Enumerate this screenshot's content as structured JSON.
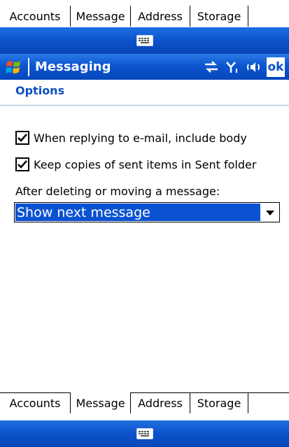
{
  "tabs_top": [
    "Accounts",
    "Message",
    "Address",
    "Storage"
  ],
  "tabs_bottom": [
    "Accounts",
    "Message",
    "Address",
    "Storage"
  ],
  "selected_tab_bottom": "Message",
  "titlebar": {
    "title": "Messaging",
    "ok_label": "ok",
    "icons": [
      "windows-start-icon",
      "connectivity-icon",
      "signal-icon",
      "speaker-icon"
    ]
  },
  "options": {
    "header": "Options",
    "include_body_label": "When replying to e-mail, include body",
    "include_body_checked": true,
    "keep_copies_label": "Keep copies of sent items in Sent folder",
    "keep_copies_checked": true,
    "after_delete_label": "After deleting or moving a message:",
    "after_delete_value": "Show next message"
  },
  "colors": {
    "titlebar_blue": "#0c55cf",
    "selection_blue": "#0a52d2",
    "header_blue": "#0b4fc4"
  }
}
